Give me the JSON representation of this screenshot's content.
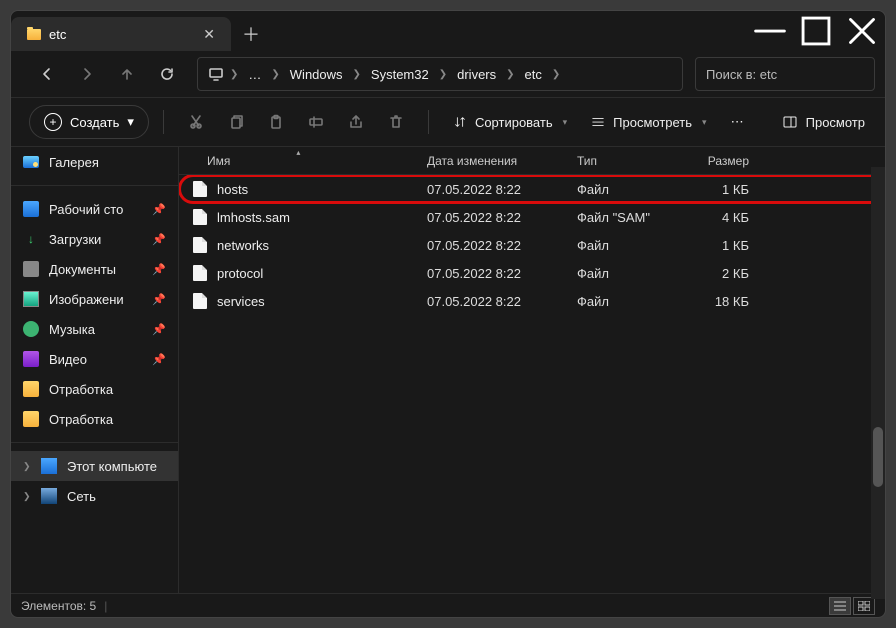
{
  "tab": {
    "title": "etc"
  },
  "breadcrumb": {
    "segs": [
      "Windows",
      "System32",
      "drivers",
      "etc"
    ]
  },
  "search": {
    "placeholder": "Поиск в: etc"
  },
  "toolbar": {
    "new_label": "Создать",
    "sort_label": "Сортировать",
    "view_label": "Просмотреть",
    "preview_label": "Просмотр"
  },
  "sidebar": {
    "gallery": "Галерея",
    "items": [
      {
        "label": "Рабочий сто",
        "ico": "blue",
        "pin": true
      },
      {
        "label": "Загрузки",
        "ico": "dl",
        "pin": true
      },
      {
        "label": "Документы",
        "ico": "gray",
        "pin": true
      },
      {
        "label": "Изображени",
        "ico": "teal",
        "pin": true
      },
      {
        "label": "Музыка",
        "ico": "green",
        "pin": true
      },
      {
        "label": "Видео",
        "ico": "purple",
        "pin": true
      },
      {
        "label": "Отработка",
        "ico": "orange",
        "pin": false
      },
      {
        "label": "Отработка",
        "ico": "orange",
        "pin": false
      }
    ],
    "thispc": "Этот компьюте",
    "network": "Сеть"
  },
  "columns": {
    "name": "Имя",
    "date": "Дата изменения",
    "type": "Тип",
    "size": "Размер"
  },
  "files": [
    {
      "name": "hosts",
      "date": "07.05.2022 8:22",
      "type": "Файл",
      "size": "1 КБ",
      "highlight": true
    },
    {
      "name": "lmhosts.sam",
      "date": "07.05.2022 8:22",
      "type": "Файл \"SAM\"",
      "size": "4 КБ"
    },
    {
      "name": "networks",
      "date": "07.05.2022 8:22",
      "type": "Файл",
      "size": "1 КБ"
    },
    {
      "name": "protocol",
      "date": "07.05.2022 8:22",
      "type": "Файл",
      "size": "2 КБ"
    },
    {
      "name": "services",
      "date": "07.05.2022 8:22",
      "type": "Файл",
      "size": "18 КБ"
    }
  ],
  "status": {
    "count_label": "Элементов: 5"
  }
}
